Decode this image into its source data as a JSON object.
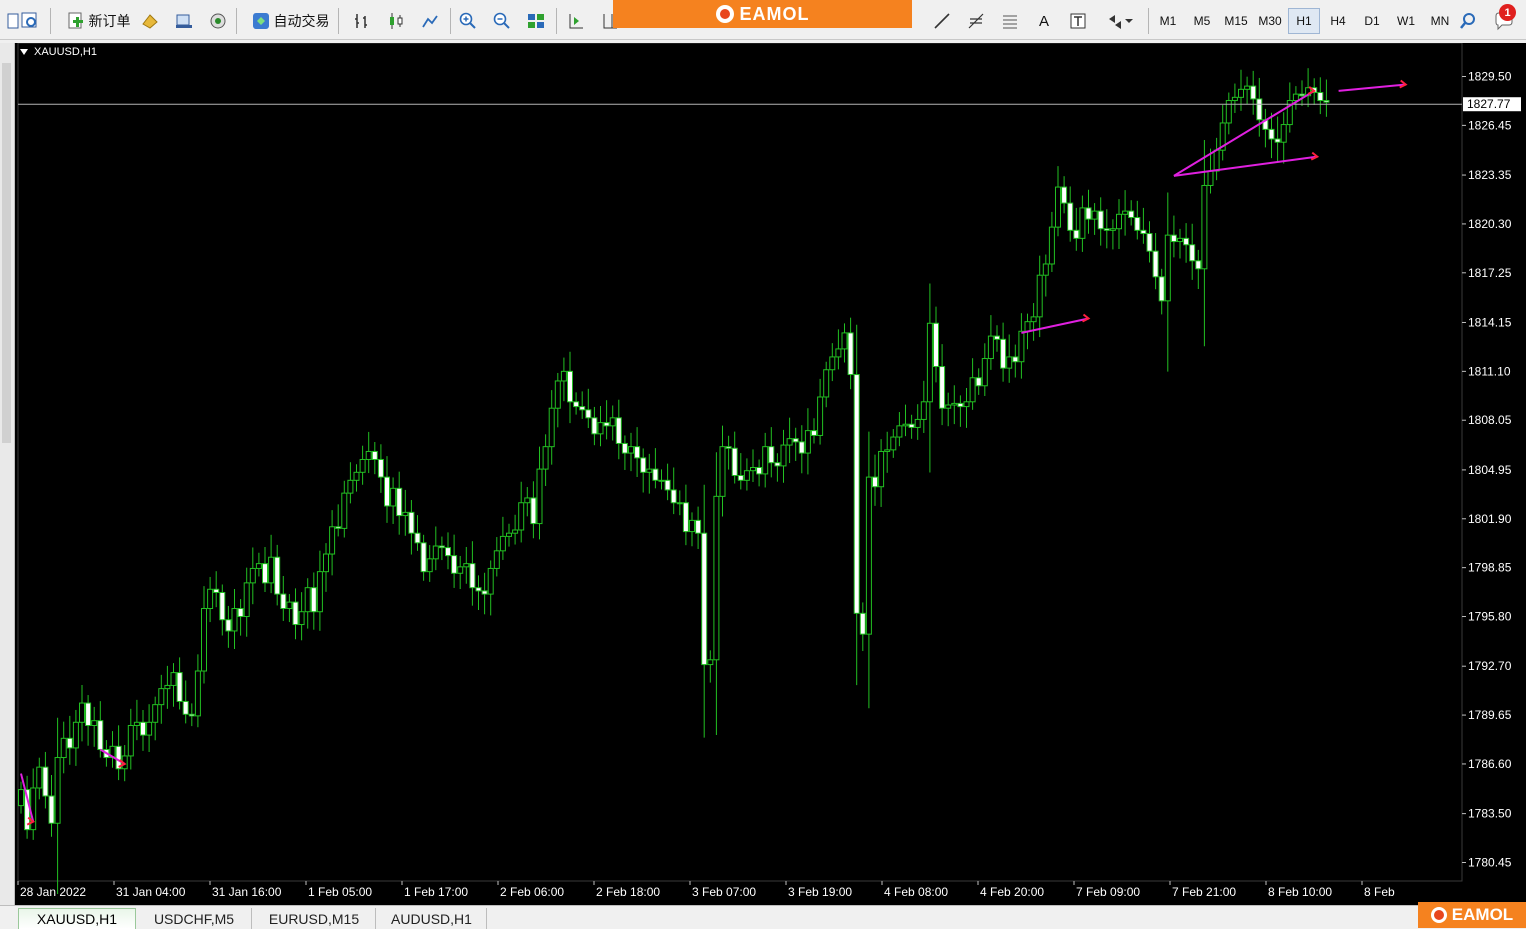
{
  "toolbar": {
    "new_order": "新订单",
    "auto_trading": "自动交易",
    "timeframes": [
      "M1",
      "M5",
      "M15",
      "M30",
      "H1",
      "H4",
      "D1",
      "W1",
      "MN"
    ],
    "active_timeframe": "H1",
    "notification_count": "1",
    "text_tool": "A"
  },
  "banner": {
    "brand": "EAMOL"
  },
  "watermark": {
    "brand": "EAMOL"
  },
  "chart": {
    "symbol_title": "XAUUSD,H1",
    "current_price_label": "1827.77"
  },
  "tabs": [
    "XAUUSD,H1",
    "USDCHF,M5",
    "EURUSD,M15",
    "AUDUSD,H1"
  ],
  "active_tab": "XAUUSD,H1",
  "chart_data": {
    "type": "candlestick",
    "symbol": "XAUUSD",
    "timeframe": "H1",
    "y_ticks": [
      1829.5,
      1826.45,
      1823.35,
      1820.3,
      1817.25,
      1814.15,
      1811.1,
      1808.05,
      1804.95,
      1801.9,
      1798.85,
      1795.8,
      1792.7,
      1789.65,
      1786.6,
      1783.5,
      1780.45
    ],
    "ylim": [
      1779.35,
      1831.25
    ],
    "x_ticks": [
      "28 Jan 2022",
      "31 Jan 04:00",
      "31 Jan 16:00",
      "1 Feb 05:00",
      "1 Feb 17:00",
      "2 Feb 06:00",
      "2 Feb 18:00",
      "3 Feb 07:00",
      "3 Feb 19:00",
      "4 Feb 08:00",
      "4 Feb 20:00",
      "7 Feb 09:00",
      "7 Feb 21:00",
      "8 Feb 10:00",
      "8 Feb"
    ],
    "current_price": 1827.77,
    "colors": {
      "background": "#000000",
      "bull_body": "#000000",
      "bear_body": "#ffffff",
      "wick": "#22c022",
      "trend_line": "#e020e0",
      "arrow": "#ff2040",
      "price_line": "#b4b4b4"
    },
    "grid": false,
    "closes": [
      1785.0,
      1782.5,
      1785.1,
      1786.4,
      1784.6,
      1782.9,
      1787.0,
      1788.2,
      1787.6,
      1789.2,
      1790.4,
      1789.0,
      1789.3,
      1787.5,
      1787.0,
      1787.7,
      1786.3,
      1787.1,
      1789.0,
      1789.2,
      1788.4,
      1789.2,
      1790.3,
      1791.3,
      1791.5,
      1792.3,
      1790.5,
      1789.7,
      1789.6,
      1792.4,
      1796.3,
      1797.5,
      1797.3,
      1795.6,
      1794.9,
      1796.3,
      1795.8,
      1797.9,
      1798.8,
      1799.1,
      1797.9,
      1799.5,
      1797.2,
      1796.3,
      1796.7,
      1795.3,
      1796.1,
      1797.6,
      1796.1,
      1798.6,
      1799.7,
      1801.4,
      1801.3,
      1803.5,
      1804.3,
      1804.8,
      1805.6,
      1806.1,
      1805.6,
      1804.5,
      1802.7,
      1803.8,
      1802.1,
      1802.3,
      1801.0,
      1800.4,
      1798.6,
      1799.4,
      1800.2,
      1800.1,
      1799.6,
      1798.5,
      1798.9,
      1799.1,
      1797.6,
      1797.4,
      1797.2,
      1798.8,
      1799.9,
      1800.8,
      1801.0,
      1801.2,
      1802.9,
      1803.2,
      1801.6,
      1805.0,
      1806.4,
      1808.8,
      1810.5,
      1811.1,
      1809.2,
      1808.9,
      1808.7,
      1808.2,
      1807.2,
      1807.9,
      1807.7,
      1808.2,
      1806.6,
      1806.0,
      1806.4,
      1805.7,
      1804.8,
      1805.0,
      1804.3,
      1804.3,
      1803.7,
      1802.9,
      1802.9,
      1801.1,
      1801.8,
      1801.0,
      1792.8,
      1793.1,
      1803.3,
      1806.4,
      1806.3,
      1804.6,
      1804.3,
      1804.9,
      1805.1,
      1804.7,
      1806.4,
      1805.4,
      1805.2,
      1806.5,
      1806.9,
      1806.7,
      1806.0,
      1807.4,
      1807.1,
      1809.5,
      1811.2,
      1812.0,
      1812.5,
      1813.5,
      1810.9,
      1796.0,
      1794.7,
      1804.5,
      1803.9,
      1806.1,
      1806.2,
      1807.0,
      1807.7,
      1807.8,
      1807.6,
      1808.1,
      1809.2,
      1814.1,
      1811.4,
      1808.8,
      1809.0,
      1809.1,
      1808.9,
      1809.2,
      1810.7,
      1810.2,
      1811.9,
      1813.3,
      1813.1,
      1811.3,
      1812.0,
      1811.7,
      1813.6,
      1814.2,
      1814.5,
      1817.1,
      1817.8,
      1820.1,
      1822.6,
      1821.6,
      1819.9,
      1819.4,
      1821.3,
      1820.6,
      1821.1,
      1820.0,
      1819.9,
      1820.0,
      1820.9,
      1821.1,
      1820.7,
      1819.9,
      1819.7,
      1818.6,
      1817.0,
      1815.5,
      1819.6,
      1819.2,
      1819.4,
      1819.0,
      1818.0,
      1817.5,
      1822.7,
      1823.6,
      1824.9,
      1826.6,
      1828.0,
      1828.2,
      1828.7,
      1828.9,
      1828.1,
      1826.8,
      1826.2,
      1825.6,
      1825.4,
      1826.5,
      1828.0,
      1828.4,
      1828.3,
      1828.8,
      1828.5,
      1828.0,
      1827.9
    ]
  }
}
